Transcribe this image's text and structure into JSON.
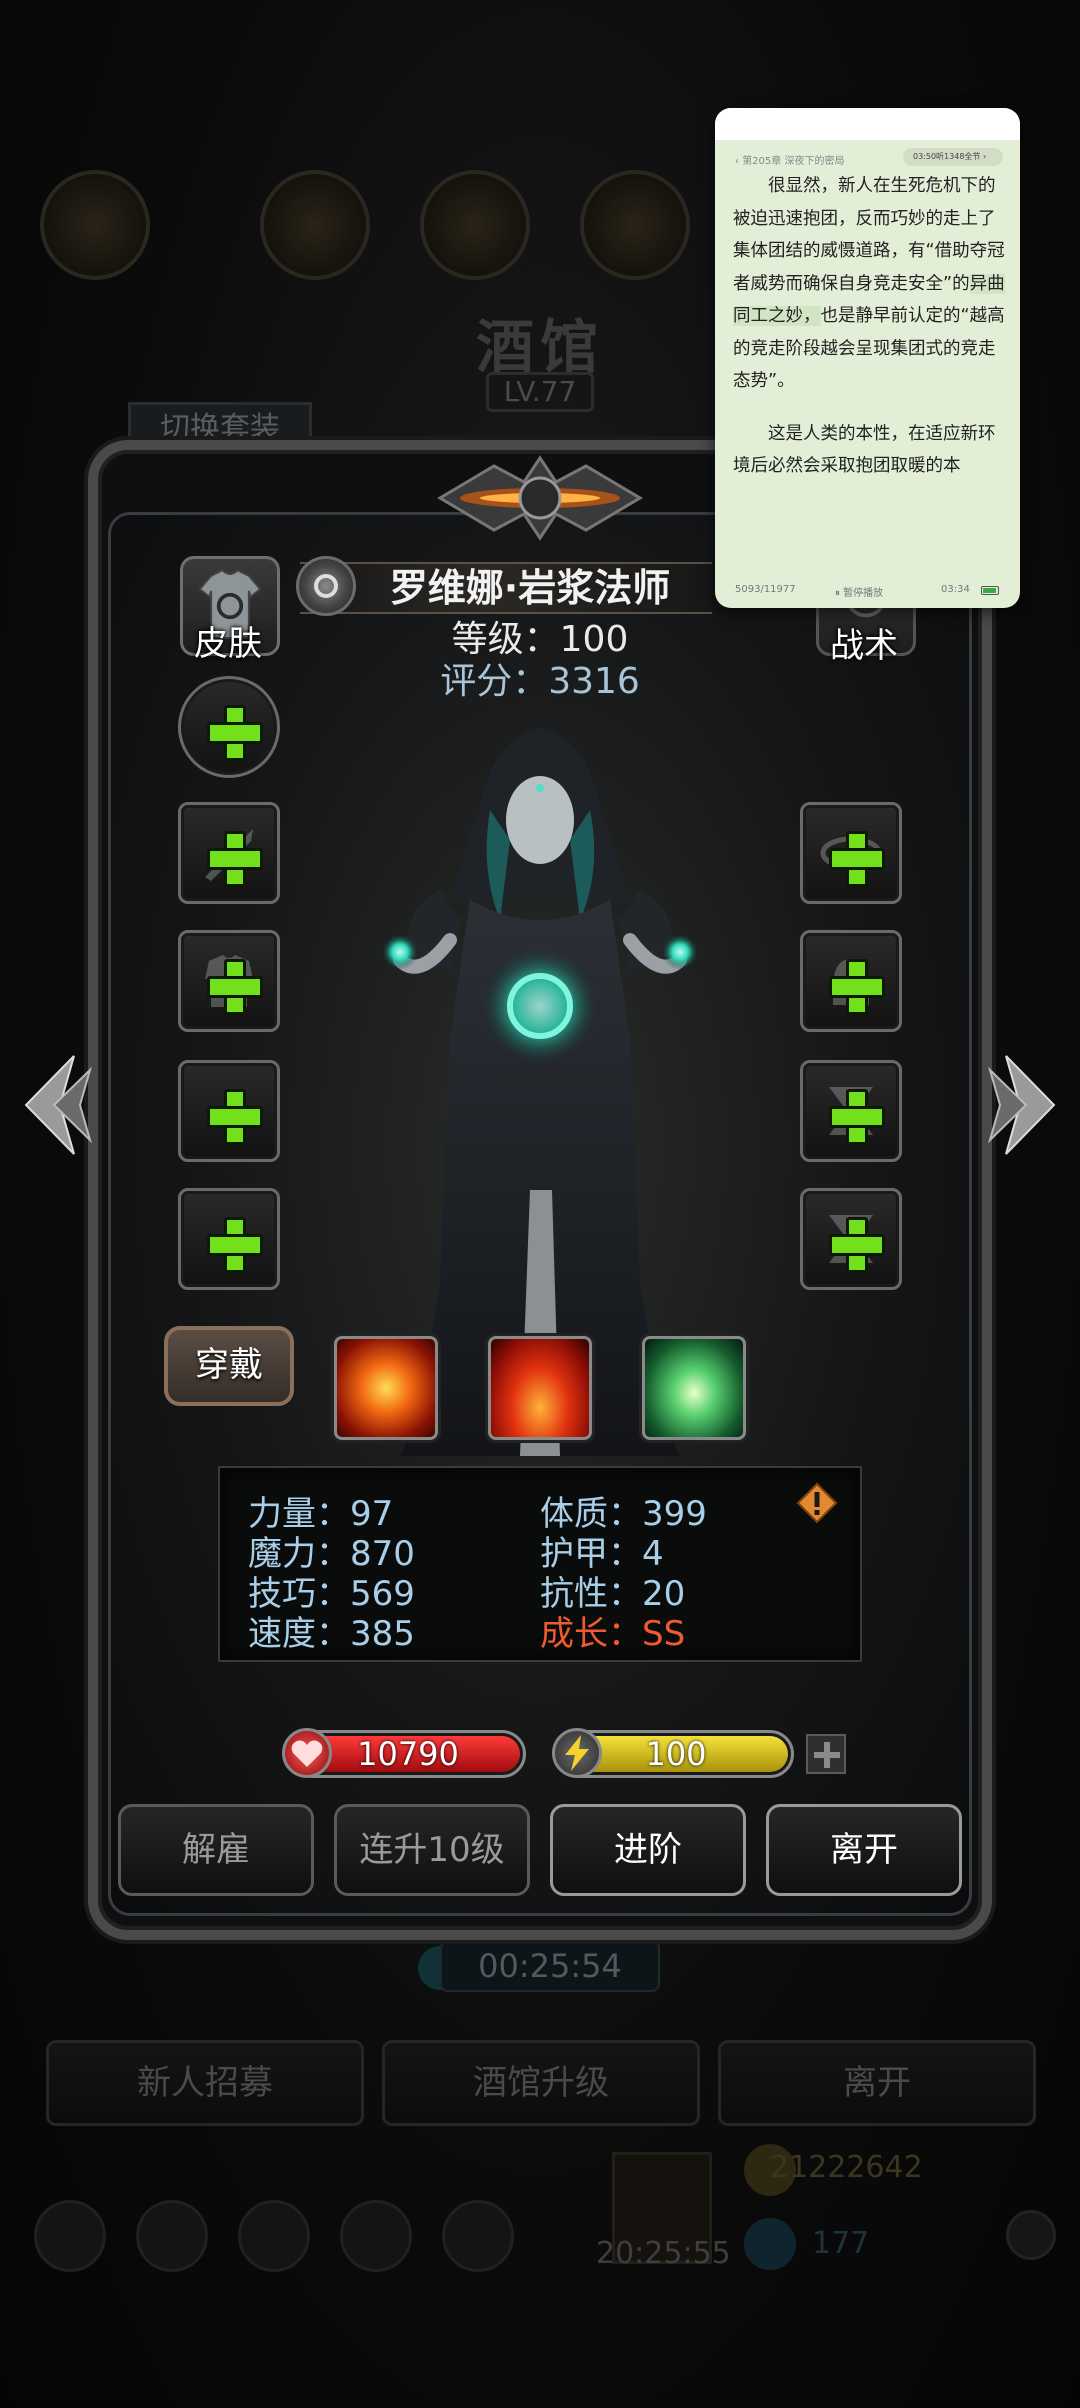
{
  "background": {
    "tavern_title": "酒馆",
    "tavern_level": "LV.77",
    "switch_outfit_label": "切换套装",
    "timer": "00:25:54",
    "buttons": [
      "新人招募",
      "酒馆升级",
      "离开"
    ],
    "bottom_timer": "20:25:55",
    "gold": "21222642",
    "gems": "177"
  },
  "hero": {
    "name": "罗维娜·岩浆法师",
    "level_text": "等级：100",
    "score_text": "评分：3316",
    "skin_label": "皮肤",
    "tactics_label": "战术",
    "wear_label": "穿戴"
  },
  "stats": {
    "strength": "力量：97",
    "physique": "体质：399",
    "magic": "魔力：870",
    "armor": "护甲：4",
    "skill": "技巧：569",
    "resistance": "抗性：20",
    "speed": "速度：385",
    "growth": "成长：SS"
  },
  "bars": {
    "hp": "10790",
    "energy": "100"
  },
  "actions": {
    "dismiss": "解雇",
    "level_up_10": "连升10级",
    "advance": "进阶",
    "leave": "离开"
  },
  "reader": {
    "chapter": "第205章 深夜下的密局",
    "listen_label": "03:50听1348全节",
    "para1_a": "很显然，新人在生死危机下的被迫迅速抱团，反而巧妙的走上了集体团结的威慑道路，有“借助夺冠者威势而确保自身竞走安全”的",
    "para1_hl": "异曲同工之妙，",
    "para1_b": "也是静早前认定的“越高的竞走阶段越会呈现集团式的竞走态势”。",
    "para2": "这是人类的本性，在适应新环境后必然会采取抱团取暖的本",
    "progress": "5093/11977",
    "pause_label": "⏸ 暂停播放",
    "time": "03:34"
  },
  "colors": {
    "stat_text": "#a9cfe8",
    "growth_text": "#f05a30",
    "plus_green": "#72e01a",
    "hp_red": "#c8141a",
    "energy_yellow": "#d8c21a",
    "reader_bg": "#e3eed7"
  },
  "icons": {
    "skin": "shirt-refresh-icon",
    "tactics": "tactics-icon",
    "rank": "rank-badge-icon",
    "warning": "warning-icon",
    "hp": "heart-icon",
    "energy": "lightning-icon",
    "nav_left": "chevron-left-icon",
    "nav_right": "chevron-right-icon"
  }
}
